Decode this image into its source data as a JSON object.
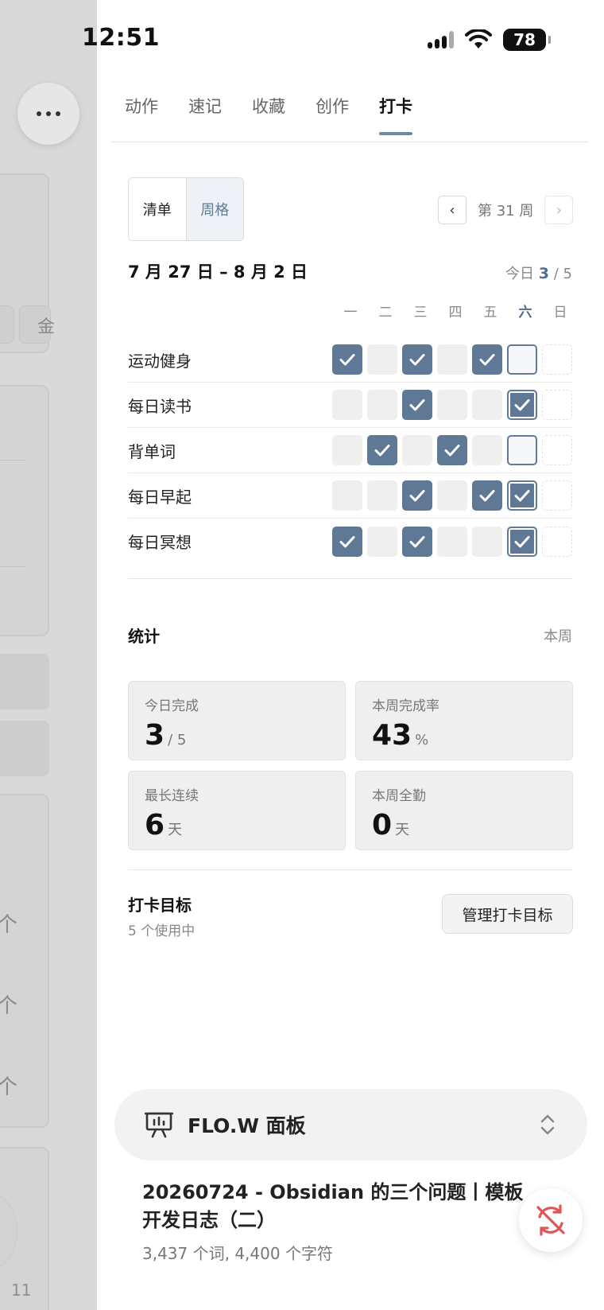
{
  "status_bar": {
    "time": "12:51",
    "battery": "78"
  },
  "left_panel": {
    "glyph_1": "金",
    "glyph_row": "个",
    "page_num": "11"
  },
  "tabs": [
    {
      "label": "动作",
      "active": false
    },
    {
      "label": "速记",
      "active": false
    },
    {
      "label": "收藏",
      "active": false
    },
    {
      "label": "创作",
      "active": false
    },
    {
      "label": "打卡",
      "active": true
    }
  ],
  "view_toggle": {
    "list": "清单",
    "week": "周格",
    "selected": "周格"
  },
  "week_nav": {
    "prev": "‹",
    "label": "第 31 周",
    "next": "›"
  },
  "date_range": "7 月 27 日 – 8 月 2 日",
  "today_summary": {
    "prefix": "今日",
    "done": "3",
    "sep": "/",
    "total": "5"
  },
  "weekdays": [
    "一",
    "二",
    "三",
    "四",
    "五",
    "六",
    "日"
  ],
  "today_index": 5,
  "habits": [
    {
      "name": "运动健身",
      "checks": [
        true,
        false,
        true,
        false,
        true,
        false,
        null
      ]
    },
    {
      "name": "每日读书",
      "checks": [
        false,
        false,
        true,
        false,
        false,
        true,
        null
      ]
    },
    {
      "name": "背单词",
      "checks": [
        false,
        true,
        false,
        true,
        false,
        false,
        null
      ]
    },
    {
      "name": "每日早起",
      "checks": [
        false,
        false,
        true,
        false,
        true,
        true,
        null
      ]
    },
    {
      "name": "每日冥想",
      "checks": [
        true,
        false,
        true,
        false,
        false,
        true,
        null
      ]
    }
  ],
  "stats": {
    "title": "统计",
    "range": "本周",
    "cards": [
      {
        "label": "今日完成",
        "value": "3",
        "unit": "/ 5"
      },
      {
        "label": "本周完成率",
        "value": "43",
        "unit": "%"
      },
      {
        "label": "最长连续",
        "value": "6",
        "unit": "天"
      },
      {
        "label": "本周全勤",
        "value": "0",
        "unit": "天"
      }
    ]
  },
  "goals": {
    "title": "打卡目标",
    "subtitle": "5 个使用中",
    "manage_button": "管理打卡目标"
  },
  "flow_panel": {
    "title": "FLO.W 面板"
  },
  "note": {
    "title": "20260724 - Obsidian 的三个问题丨模板开发日志（二）",
    "meta": "3,437 个词, 4,400 个字符"
  },
  "colors": {
    "accent": "#5f7896",
    "accent_text": "#4f6d8c",
    "sync_icon": "#e05555"
  }
}
